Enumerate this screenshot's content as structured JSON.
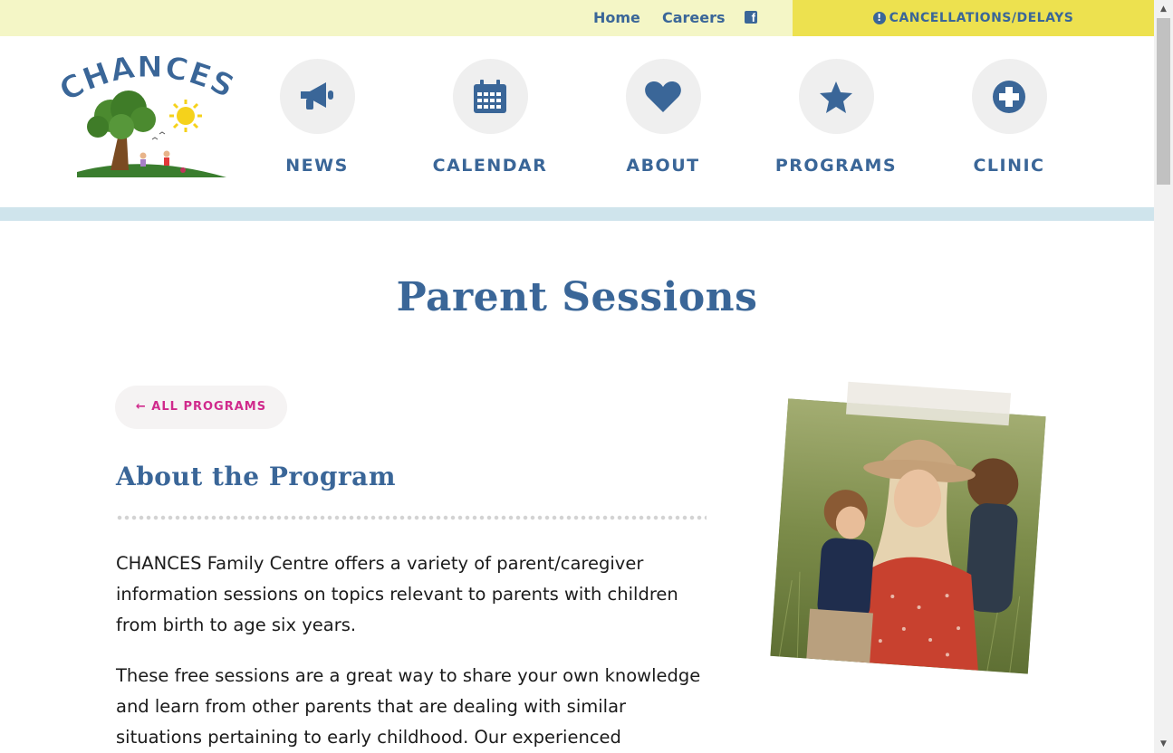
{
  "topbar": {
    "home": "Home",
    "careers": "Careers",
    "facebook_icon": "facebook-icon",
    "cancellations": "CANCELLATIONS/DELAYS",
    "alert_glyph": "!"
  },
  "logo": {
    "text": "CHANCES",
    "colors": {
      "text": "#3a6698",
      "sun": "#f5d21b",
      "grass": "#3a7d2e",
      "trunk": "#7a4b22",
      "leaves": "#4b8a2f"
    }
  },
  "nav": {
    "items": [
      {
        "label": "NEWS",
        "icon": "megaphone-icon"
      },
      {
        "label": "CALENDAR",
        "icon": "calendar-icon"
      },
      {
        "label": "ABOUT",
        "icon": "heart-icon"
      },
      {
        "label": "PROGRAMS",
        "icon": "star-icon"
      },
      {
        "label": "CLINIC",
        "icon": "plus-circle-icon"
      }
    ]
  },
  "main": {
    "title": "Parent Sessions",
    "back_button": "← ALL PROGRAMS",
    "section_title": "About the Program",
    "paragraphs": [
      "CHANCES Family Centre offers a variety of parent/caregiver information sessions on topics relevant to parents with children from birth to age six years.",
      "These free sessions are a great way to share your own knowledge and learn from other parents that are dealing with similar situations pertaining to early childhood. Our experienced"
    ]
  },
  "colors": {
    "primary_blue": "#3a6698",
    "topbar_bg": "#f4f6c6",
    "alert_yellow": "#ede14f",
    "accent_pink": "#d02a8c",
    "stripe": "#cfe4ec"
  }
}
